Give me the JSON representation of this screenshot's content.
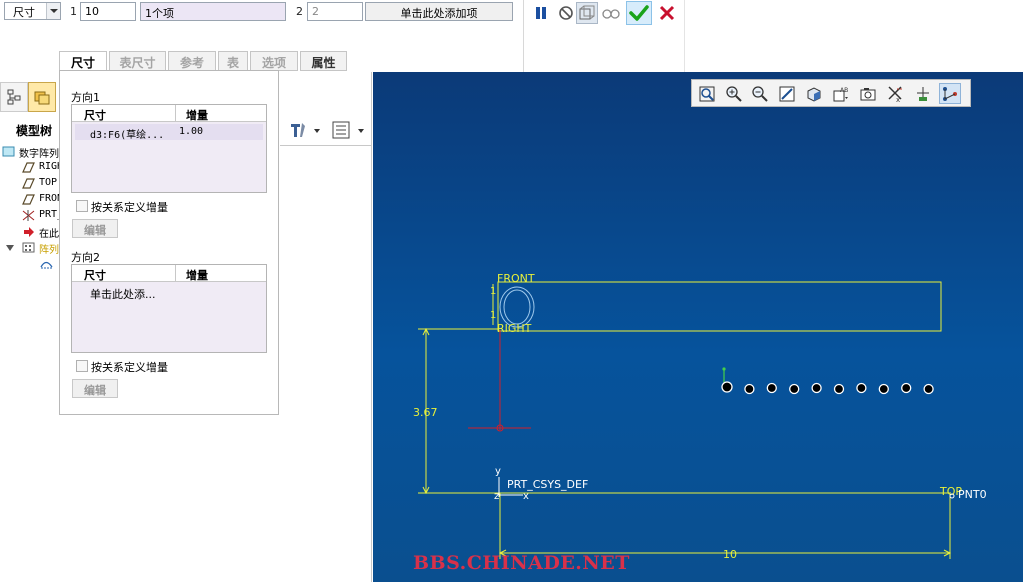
{
  "dashboard": {
    "type_select": "尺寸",
    "dir1_label": "1",
    "dir1_count": "10",
    "dir1_items": "1个项",
    "dir2_label": "2",
    "dir2_count": "2",
    "dir2_add": "单击此处添加项"
  },
  "tabs": [
    "尺寸",
    "表尺寸",
    "参考",
    "表",
    "选项",
    "属性"
  ],
  "panel": {
    "dir1_title": "方向1",
    "dir1_columns": [
      "尺寸",
      "增量"
    ],
    "dir1_rows": [
      {
        "dim": "d3:F6(草绘...",
        "inc": "1.00"
      }
    ],
    "dir1_relation": "按关系定义增量",
    "dir1_edit": "编辑",
    "dir2_title": "方向2",
    "dir2_columns": [
      "尺寸",
      "增量"
    ],
    "dir2_empty": "单击此处添...",
    "dir2_relation": "按关系定义增量",
    "dir2_edit": "编辑"
  },
  "tree": {
    "title": "模型树",
    "items": [
      {
        "text": "数字阵列",
        "icon": "part-icon"
      },
      {
        "text": "RIGHT",
        "icon": "datum-plane-icon"
      },
      {
        "text": "TOP",
        "icon": "datum-plane-icon"
      },
      {
        "text": "FRONT",
        "icon": "datum-plane-icon"
      },
      {
        "text": "PRT_CSYS_DEF",
        "icon": "csys-icon"
      },
      {
        "text": "在此插入",
        "icon": "insert-arrow-icon"
      },
      {
        "text": "阵列",
        "icon": "pattern-icon"
      },
      {
        "text": "",
        "icon": "sketch-icon"
      }
    ]
  },
  "viewport": {
    "labels": {
      "front": "FRONT",
      "right": "RIGHT",
      "csys": "PRT_CSYS_DEF",
      "top": "TOP",
      "pnt": "PNT0",
      "dim_vertical": "3.67",
      "dim_horizontal": "10",
      "y_axis": "y",
      "z_axis": "z",
      "x_axis": "x",
      "dim_small_1": "1",
      "dim_small_2": "1"
    },
    "pattern_points": 10,
    "watermark": "BBS.CHINADE.NET"
  },
  "colors": {
    "viewport_top": "#0b3a78",
    "viewport_bottom": "#06539c",
    "sketch_yellow": "#e8f03a",
    "confirm_green": "#1aa31a",
    "cancel_red": "#c8102e"
  }
}
